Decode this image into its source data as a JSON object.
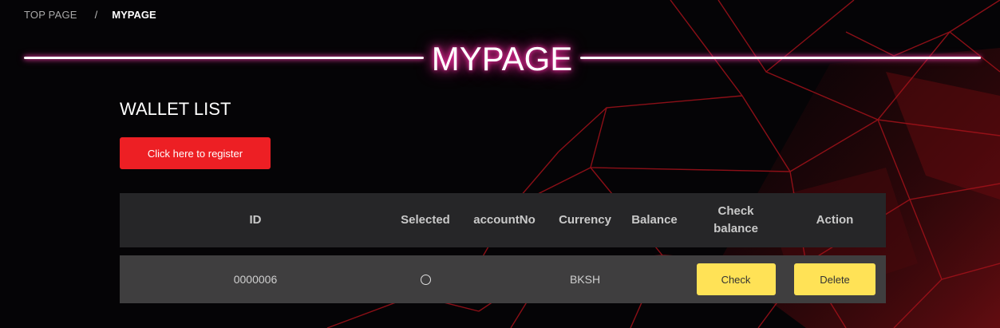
{
  "breadcrumb": {
    "home": "TOP PAGE",
    "separator": "/",
    "current": "MYPAGE"
  },
  "page_title": "MYPAGE",
  "wallet": {
    "section_title": "WALLET LIST",
    "register_label": "Click here to register",
    "columns": {
      "id": "ID",
      "selected": "Selected",
      "account_no": "accountNo",
      "currency": "Currency",
      "balance": "Balance",
      "check_balance_1": "Check",
      "check_balance_2": "balance",
      "action": "Action"
    },
    "rows": [
      {
        "id": "0000006",
        "selected_symbol": "radio-empty-icon",
        "account_no": "",
        "currency": "BKSH",
        "balance": "",
        "check_label": "Check",
        "delete_label": "Delete"
      }
    ]
  },
  "colors": {
    "background": "#050406",
    "accent_red": "#ed1f24",
    "button_yellow": "#ffe256",
    "title_glow": "#ff2fa8",
    "table_header": "#262628",
    "table_row": "#3f3e3f"
  }
}
